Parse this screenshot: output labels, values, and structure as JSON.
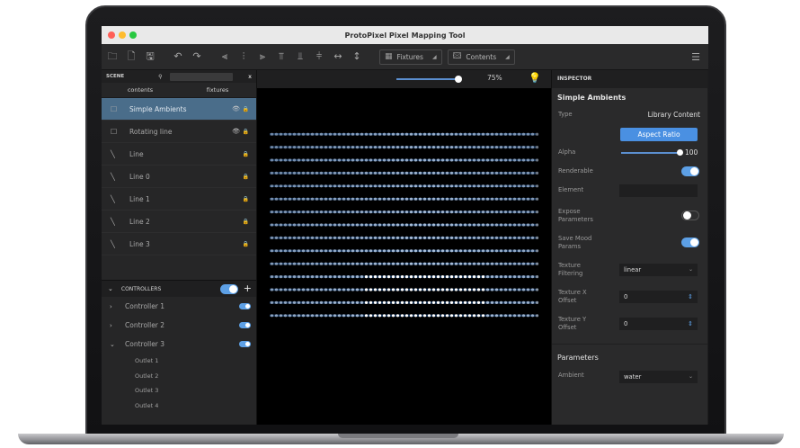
{
  "app": {
    "title": "ProtoPixel Pixel Mapping Tool"
  },
  "toolbar": {
    "fixtures_label": "Fixtures",
    "contents_label": "Contents"
  },
  "scene": {
    "header": "SCENE",
    "tabs": [
      "contents",
      "fixtures"
    ],
    "items": [
      {
        "label": "Simple Ambients",
        "selected": true,
        "type": "content"
      },
      {
        "label": "Rotating line",
        "selected": false,
        "type": "content"
      },
      {
        "label": "Line",
        "selected": false,
        "type": "line"
      },
      {
        "label": "Line 0",
        "selected": false,
        "type": "line"
      },
      {
        "label": "Line 1",
        "selected": false,
        "type": "line"
      },
      {
        "label": "Line 2",
        "selected": false,
        "type": "line"
      },
      {
        "label": "Line 3",
        "selected": false,
        "type": "line"
      }
    ]
  },
  "controllers": {
    "header": "CONTROLLERS",
    "items": [
      {
        "label": "Controller 1",
        "expanded": false
      },
      {
        "label": "Controller 2",
        "expanded": false
      },
      {
        "label": "Controller 3",
        "expanded": true
      }
    ],
    "outlets": [
      "Outlet 1",
      "Outlet 2",
      "Outlet 3",
      "Outlet 4"
    ]
  },
  "viewport": {
    "zoom": "75%",
    "zoom_level": 0.75,
    "led_rows": 15,
    "led_cols": 60,
    "led_color": "#cfe4ff"
  },
  "inspector": {
    "header": "INSPECTOR",
    "title": "Simple Ambients",
    "type_label": "Type",
    "type_value": "Library Content",
    "aspect_ratio_label": "Aspect Ratio",
    "alpha_label": "Alpha",
    "alpha_value": "100",
    "renderable_label": "Renderable",
    "element_label": "Element",
    "expose_label_1": "Expose",
    "expose_label_2": "Parameters",
    "save_mood_label_1": "Save Mood",
    "save_mood_label_2": "Params",
    "texture_filtering_label_1": "Texture",
    "texture_filtering_label_2": "Filtering",
    "texture_filtering_value": "linear",
    "texture_x_label_1": "Texture X",
    "texture_x_label_2": "Offset",
    "texture_x_value": "0",
    "texture_y_label_1": "Texture Y",
    "texture_y_label_2": "Offset",
    "texture_y_value": "0",
    "parameters_title": "Parameters",
    "ambient_label": "Ambient",
    "ambient_value": "water"
  },
  "colors": {
    "accent": "#4a90e2",
    "selection": "#4a6d8a",
    "bulb": "#f4d03f"
  }
}
